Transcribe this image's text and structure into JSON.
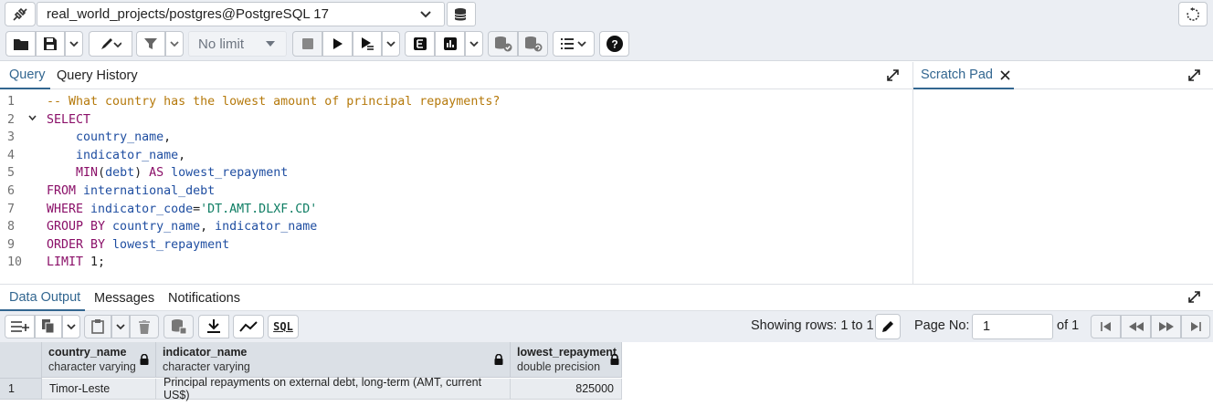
{
  "connection": {
    "label": "real_world_projects/postgres@PostgreSQL 17"
  },
  "toolbar": {
    "limit_label": "No limit"
  },
  "editor_tabs": {
    "query": "Query",
    "history": "Query History",
    "scratch": "Scratch Pad"
  },
  "editor": {
    "line_numbers": [
      "1",
      "2",
      "3",
      "4",
      "5",
      "6",
      "7",
      "8",
      "9",
      "10"
    ],
    "lines": [
      [
        [
          "c-comment",
          "-- What country has the lowest amount of principal repayments?"
        ]
      ],
      [
        [
          "c-kw",
          "SELECT"
        ]
      ],
      [
        [
          "",
          "    "
        ],
        [
          "c-id",
          "country_name"
        ],
        [
          "",
          ","
        ]
      ],
      [
        [
          "",
          "    "
        ],
        [
          "c-id",
          "indicator_name"
        ],
        [
          "",
          ","
        ]
      ],
      [
        [
          "",
          "    "
        ],
        [
          "c-fn",
          "MIN"
        ],
        [
          "",
          "("
        ],
        [
          "c-id",
          "debt"
        ],
        [
          "",
          ") "
        ],
        [
          "c-kw",
          "AS"
        ],
        [
          "c-id",
          " lowest_repayment"
        ]
      ],
      [
        [
          "c-kw",
          "FROM"
        ],
        [
          "c-id",
          " international_debt"
        ]
      ],
      [
        [
          "c-kw",
          "WHERE"
        ],
        [
          "c-id",
          " indicator_code"
        ],
        [
          "",
          "="
        ],
        [
          "c-str",
          "'DT.AMT.DLXF.CD'"
        ]
      ],
      [
        [
          "c-kw",
          "GROUP BY"
        ],
        [
          "c-id",
          " country_name"
        ],
        [
          "",
          ", "
        ],
        [
          "c-id",
          "indicator_name"
        ]
      ],
      [
        [
          "c-kw",
          "ORDER BY"
        ],
        [
          "c-id",
          " lowest_repayment"
        ]
      ],
      [
        [
          "c-kw",
          "LIMIT"
        ],
        [
          "",
          " 1;"
        ]
      ]
    ]
  },
  "result_tabs": {
    "data_output": "Data Output",
    "messages": "Messages",
    "notifications": "Notifications"
  },
  "result_toolbar": {
    "sql_label": "SQL",
    "showing": "Showing rows: 1 to 1",
    "page_no_label": "Page No:",
    "page_no_value": "1",
    "of_label": "of 1"
  },
  "grid": {
    "columns": [
      {
        "name": "country_name",
        "type": "character varying"
      },
      {
        "name": "indicator_name",
        "type": "character varying"
      },
      {
        "name": "lowest_repayment",
        "type": "double precision"
      }
    ],
    "rows": [
      {
        "num": "1",
        "country_name": "Timor-Leste",
        "indicator_name": "Principal repayments on external debt, long-term (AMT, current US$)",
        "lowest_repayment": "825000"
      }
    ]
  },
  "colors": {
    "accent": "#326690",
    "toolbar_bg": "#ebeef3",
    "grid_header_bg": "#dbe0e6",
    "keyword": "#8a0f68",
    "identifier": "#1f4ea1",
    "comment": "#b5790b",
    "string": "#0e7d63"
  }
}
